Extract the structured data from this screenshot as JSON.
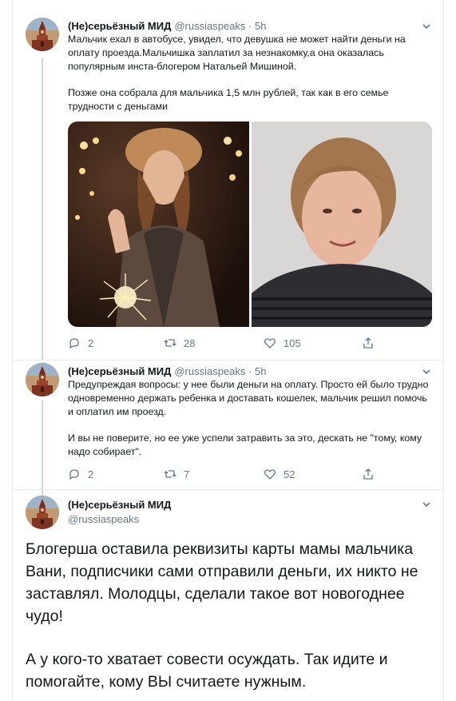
{
  "tweets": [
    {
      "name": "(Не)серьёзный МИД",
      "handle": "@russiaspeaks",
      "time": "· 5h",
      "paragraphs": [
        "Мальчик ехал в автобусе, увидел, что девушка не может найти деньги на оплату проезда.Мальчишка заплатил за незнакомку,а она оказалась популярным инста-блогером Натальей Мишиной.",
        "Позже она собрала для мальчика 1,5 млн рублей, так как в его семье трудности с деньгами"
      ],
      "replies": "2",
      "retweets": "28",
      "likes": "105",
      "media": [
        {
          "name": "photo-woman-sparkler",
          "icon": "photo"
        },
        {
          "name": "photo-woman-portrait",
          "icon": "photo"
        }
      ]
    },
    {
      "name": "(Не)серьёзный МИД",
      "handle": "@russiaspeaks",
      "time": "· 5h",
      "paragraphs": [
        "Предупреждая вопросы: у нее были деньги на оплату. Просто ей было трудно одновременно держать ребенка и доставать кошелек, мальчик решил помочь и оплатил им проезд.",
        "И вы не поверите, но ее уже успели затравить за это, дескать не \"тому, кому надо собирает\"."
      ],
      "replies": "2",
      "retweets": "7",
      "likes": "52"
    },
    {
      "name": "(Не)серьёзный МИД",
      "handle": "@russiaspeaks",
      "paragraphs": [
        "Блогерша оставила реквизиты карты мамы мальчика Вани, подписчики сами отправили деньги, их никто не заставлял. Молодцы, сделали такое вот новогоднее чудо!",
        "А у кого-то хватает совести осуждать. Так идите и помогайте, кому ВЫ считаете нужным."
      ]
    }
  ],
  "icons": {
    "reply": "reply-icon",
    "retweet": "retweet-icon",
    "like": "heart-icon",
    "share": "share-icon",
    "more": "chevron-down-icon",
    "avatar": "kremlin-tower-avatar"
  },
  "colors": {
    "text": "#14171a",
    "muted": "#657786",
    "border": "#e6ecf0",
    "thread": "#ccd6dd"
  }
}
